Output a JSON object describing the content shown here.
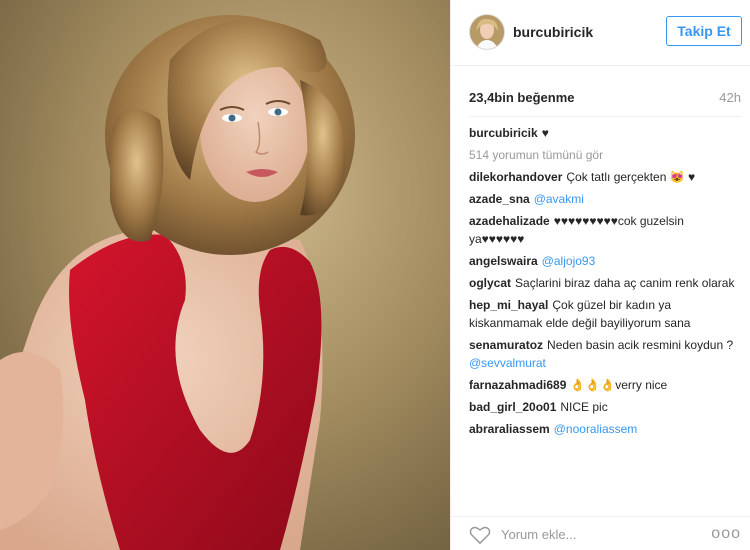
{
  "post": {
    "image_alt": "woman in red dress",
    "username": "burcubiricik",
    "follow_label": "Takip Et",
    "likes": "23,4bin beğenme",
    "time": "42h"
  },
  "caption": {
    "username": "burcubiricik",
    "text": "♥"
  },
  "view_all": "514 yorumun tümünü gör",
  "comments": [
    {
      "user": "dilekorhandover",
      "text": "Çok tatlı gerçekten 😻 ♥",
      "mention": ""
    },
    {
      "user": "azade_sna",
      "text": "",
      "mention": "@avakmi"
    },
    {
      "user": "azadehalizade",
      "text": "♥♥♥♥♥♥♥♥♥cok guzelsin ya♥♥♥♥♥♥",
      "mention": ""
    },
    {
      "user": "angelswaira",
      "text": "",
      "mention": "@aljojo93"
    },
    {
      "user": "oglycat",
      "text": "Saçlarini biraz daha aç canim renk olarak",
      "mention": ""
    },
    {
      "user": "hep_mi_hayal",
      "text": "Çok güzel bir kadın ya kiskanmamak elde değil bayiliyorum sana",
      "mention": ""
    },
    {
      "user": "senamuratoz",
      "text": "Neden basin acik resmini koydun ? ",
      "mention": "@sevvalmurat"
    },
    {
      "user": "farnazahmadi689",
      "text": "👌👌👌verry nice",
      "mention": ""
    },
    {
      "user": "bad_girl_20o01",
      "text": "NICE pic",
      "mention": ""
    },
    {
      "user": "abraraliassem",
      "text": "",
      "mention": "@nooraliassem"
    }
  ],
  "footer": {
    "add_comment_placeholder": "Yorum ekle...",
    "more_label": "ooo"
  },
  "colors": {
    "accent": "#3897f0",
    "text": "#262626",
    "muted": "#999999"
  }
}
